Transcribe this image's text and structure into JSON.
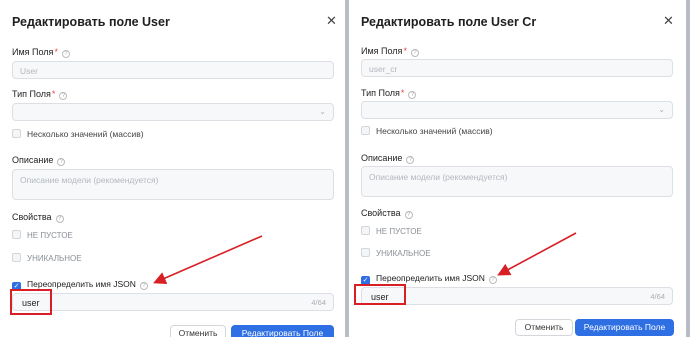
{
  "left_modal": {
    "title": "Редактировать поле User",
    "close_icon": "✕",
    "field_name_label": "Имя Поля",
    "required_mark": "*",
    "field_name_value": "User",
    "field_type_label": "Тип Поля",
    "multiple_label": "Несколько значений (массив)",
    "description_label": "Описание",
    "description_placeholder": "Описание модели (рекомендуется)",
    "properties_label": "Свойства",
    "not_empty_label": "НЕ ПУСТОЕ",
    "unique_label": "УНИКАЛЬНОЕ",
    "override_json_label": "Переопределить имя JSON",
    "json_name_value": "user",
    "json_counter": "4/64",
    "cancel_label": "Отменить",
    "submit_label": "Редактировать Поле"
  },
  "right_modal": {
    "title": "Редактировать поле User Cr",
    "close_icon": "✕",
    "field_name_label": "Имя Поля",
    "required_mark": "*",
    "field_name_value": "user_cr",
    "field_type_label": "Тип Поля",
    "multiple_label": "Несколько значений (массив)",
    "description_label": "Описание",
    "description_placeholder": "Описание модели (рекомендуется)",
    "properties_label": "Свойства",
    "not_empty_label": "НЕ ПУСТОЕ",
    "unique_label": "УНИКАЛЬНОЕ",
    "override_json_label": "Переопределить имя JSON",
    "json_name_value": "user",
    "json_counter": "4/64",
    "cancel_label": "Отменить",
    "submit_label": "Редактировать Поле"
  },
  "glyphs": {
    "help": "?",
    "chevron": "⌄",
    "check": "✓"
  },
  "colors": {
    "primary": "#2f6fe4",
    "annotation_red": "#d91f26",
    "required": "#e5484d"
  }
}
